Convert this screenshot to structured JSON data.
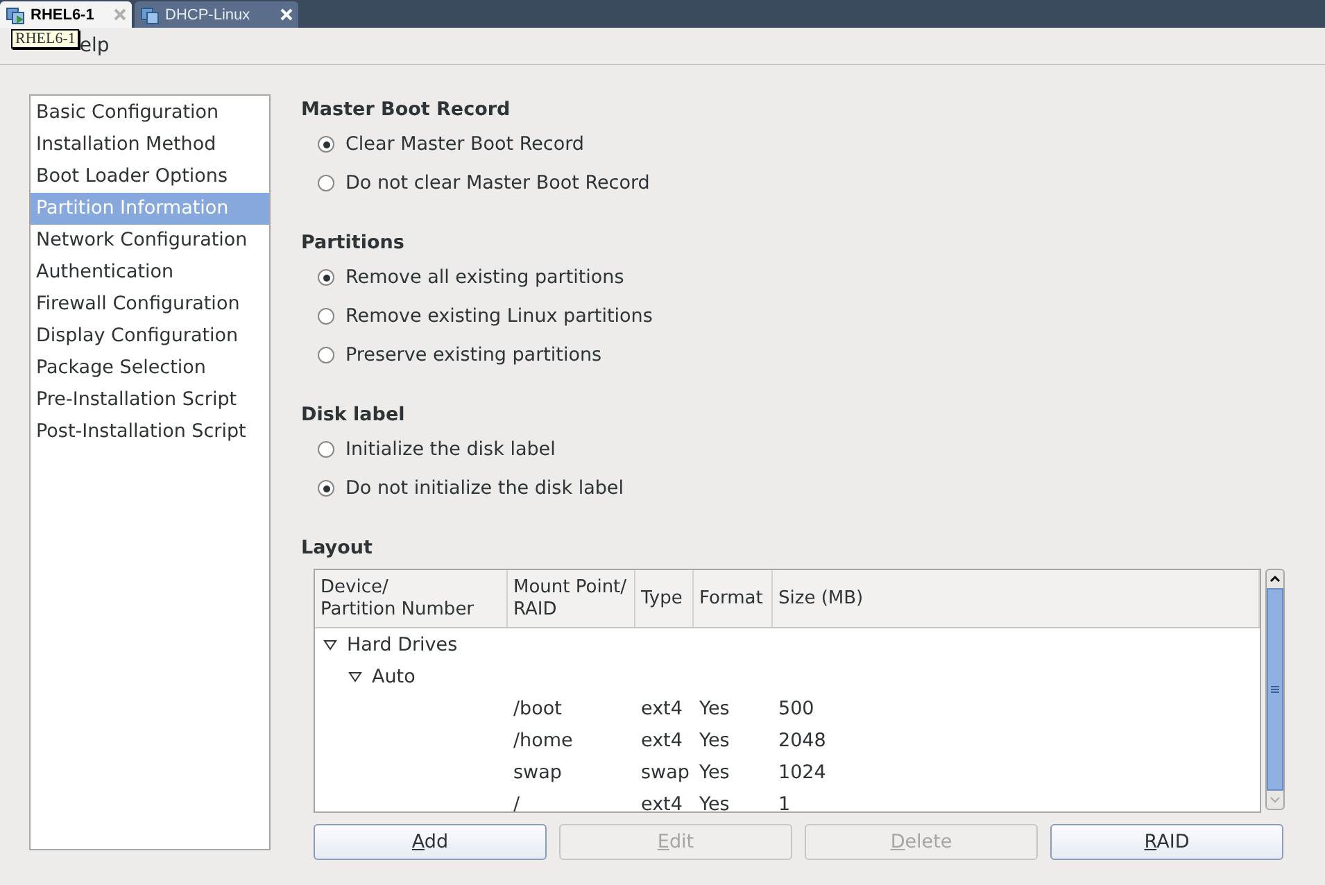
{
  "tabs": [
    {
      "label": "RHEL6-1",
      "selected": true
    },
    {
      "label": "DHCP-Linux",
      "selected": false
    }
  ],
  "tooltip": "RHEL6-1",
  "menu": [
    "elp"
  ],
  "sidebar": {
    "items": [
      {
        "label": "Basic Configuration",
        "selected": false
      },
      {
        "label": "Installation Method",
        "selected": false
      },
      {
        "label": "Boot Loader Options",
        "selected": false
      },
      {
        "label": "Partition Information",
        "selected": true
      },
      {
        "label": "Network Configuration",
        "selected": false
      },
      {
        "label": "Authentication",
        "selected": false
      },
      {
        "label": "Firewall Configuration",
        "selected": false
      },
      {
        "label": "Display Configuration",
        "selected": false
      },
      {
        "label": "Package Selection",
        "selected": false
      },
      {
        "label": "Pre-Installation Script",
        "selected": false
      },
      {
        "label": "Post-Installation Script",
        "selected": false
      }
    ]
  },
  "sections": [
    {
      "title": "Master Boot Record",
      "options": [
        {
          "label": "Clear Master Boot Record",
          "selected": true
        },
        {
          "label": "Do not clear Master Boot Record",
          "selected": false
        }
      ]
    },
    {
      "title": "Partitions",
      "options": [
        {
          "label": "Remove all existing partitions",
          "selected": true
        },
        {
          "label": "Remove existing Linux partitions",
          "selected": false
        },
        {
          "label": "Preserve existing partitions",
          "selected": false
        }
      ]
    },
    {
      "title": "Disk label",
      "options": [
        {
          "label": "Initialize the disk label",
          "selected": false
        },
        {
          "label": "Do not initialize the disk label",
          "selected": true
        }
      ]
    }
  ],
  "layout": {
    "title": "Layout",
    "columns": [
      {
        "lines": [
          "Device/",
          "Partition Number"
        ]
      },
      {
        "lines": [
          "Mount Point/",
          "RAID"
        ]
      },
      {
        "lines": [
          "Type"
        ]
      },
      {
        "lines": [
          "Format"
        ]
      },
      {
        "lines": [
          "Size (MB)"
        ]
      }
    ],
    "tree": [
      {
        "label": "Hard Drives",
        "expanded": true,
        "children": [
          {
            "label": "Auto",
            "expanded": true,
            "children": [
              {
                "mount": "/boot",
                "type": "ext4",
                "format": "Yes",
                "size": "500"
              },
              {
                "mount": "/home",
                "type": "ext4",
                "format": "Yes",
                "size": "2048"
              },
              {
                "mount": "swap",
                "type": "swap",
                "format": "Yes",
                "size": "1024"
              },
              {
                "mount": "/",
                "type": "ext4",
                "format": "Yes",
                "size": "1"
              }
            ]
          }
        ]
      }
    ]
  },
  "buttons": [
    {
      "label": "Add",
      "disabled": false
    },
    {
      "label": "Edit",
      "disabled": true
    },
    {
      "label": "Delete",
      "disabled": true
    },
    {
      "label": "RAID",
      "disabled": false
    }
  ]
}
